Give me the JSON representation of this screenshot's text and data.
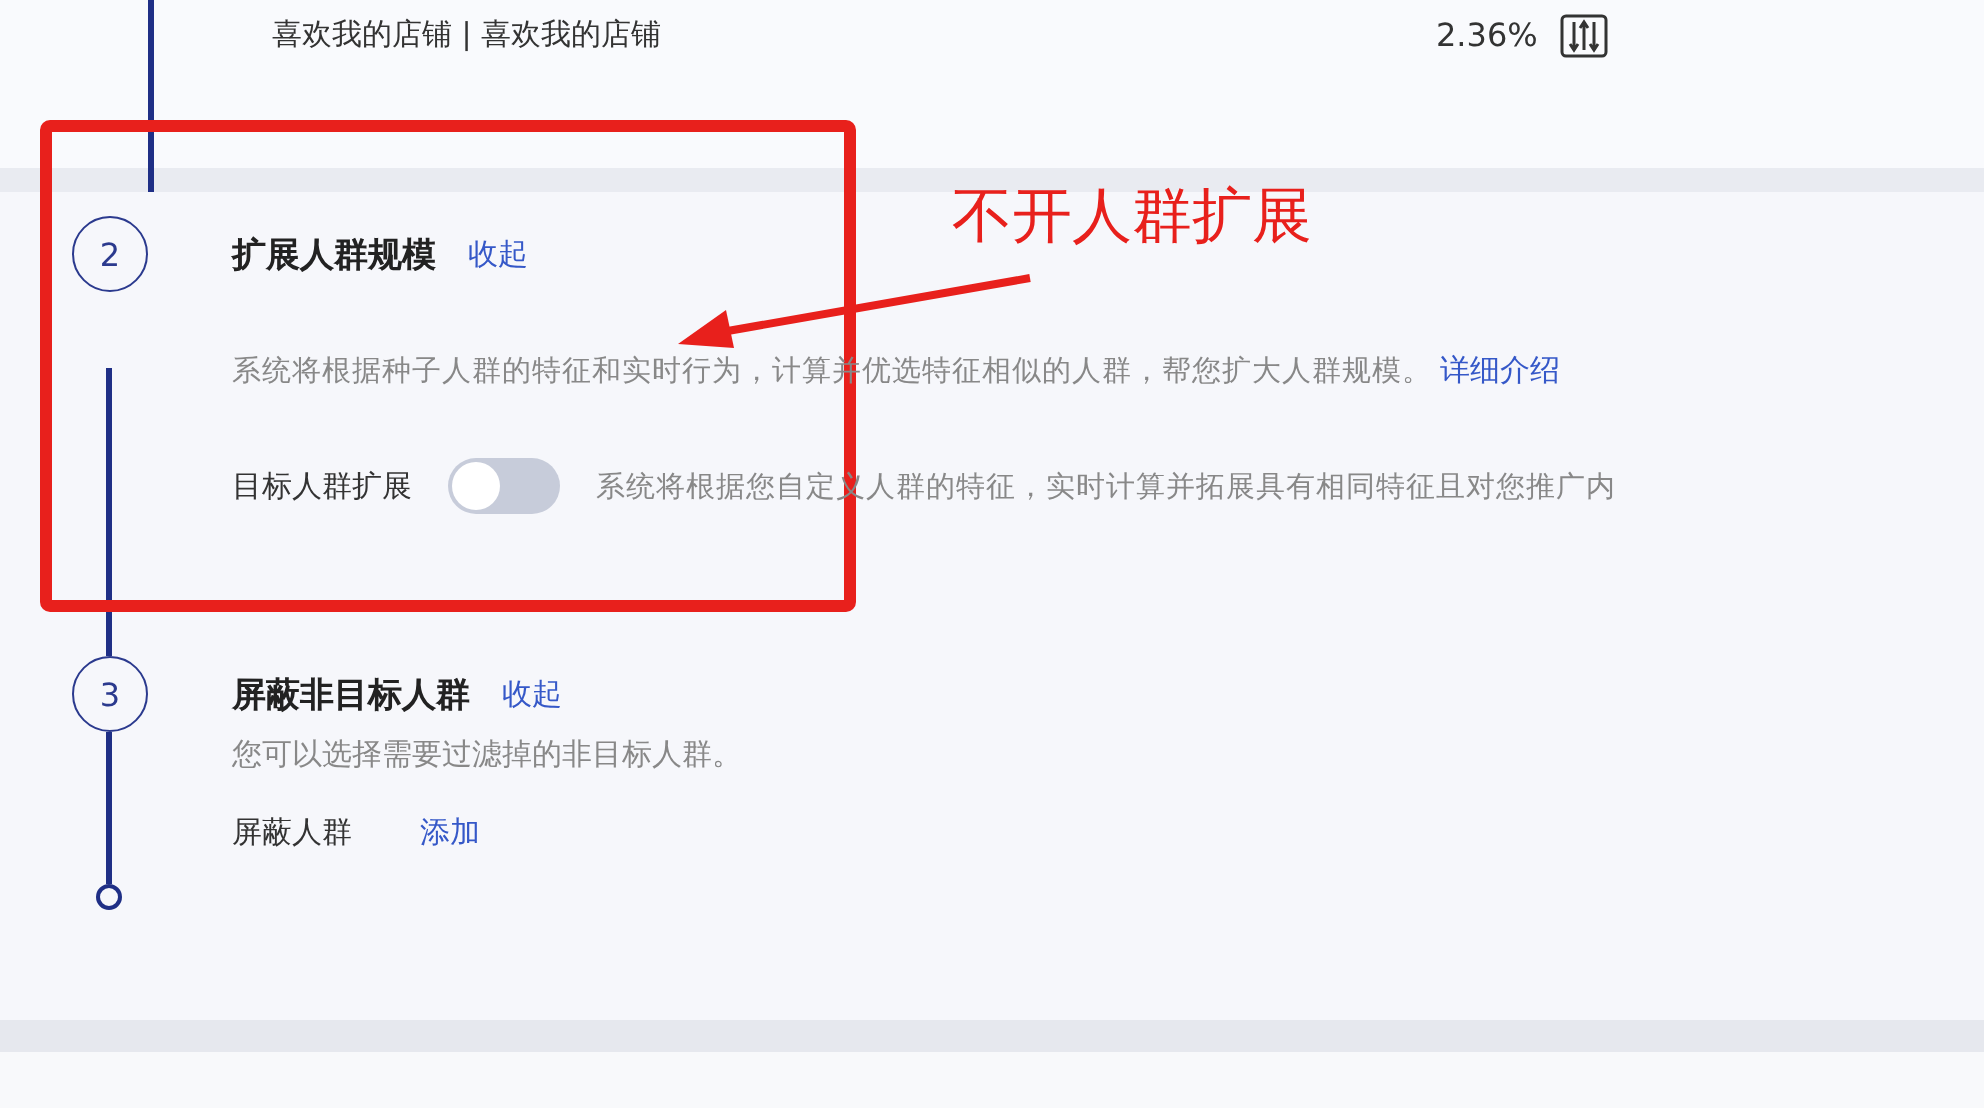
{
  "top_row": {
    "label": "喜欢我的店铺 | 喜欢我的店铺",
    "value": "2.36%"
  },
  "steps": [
    {
      "number": "2",
      "title": "扩展人群规模",
      "toggle_link": "收起",
      "description": "系统将根据种子人群的特征和实时行为，计算并优选特征相似的人群，帮您扩大人群规模。",
      "detail_link": "详细介绍",
      "settings": [
        {
          "kind": "switch",
          "label": "目标人群扩展",
          "on": false,
          "note": "系统将根据您自定义人群的特征，实时计算并拓展具有相同特征且对您推广内"
        }
      ]
    },
    {
      "number": "3",
      "title": "屏蔽非目标人群",
      "toggle_link": "收起",
      "description": "您可以选择需要过滤掉的非目标人群。",
      "settings": [
        {
          "kind": "link",
          "label": "屏蔽人群",
          "action": "添加"
        }
      ]
    }
  ],
  "annotation": {
    "text": "不开人群扩展"
  }
}
